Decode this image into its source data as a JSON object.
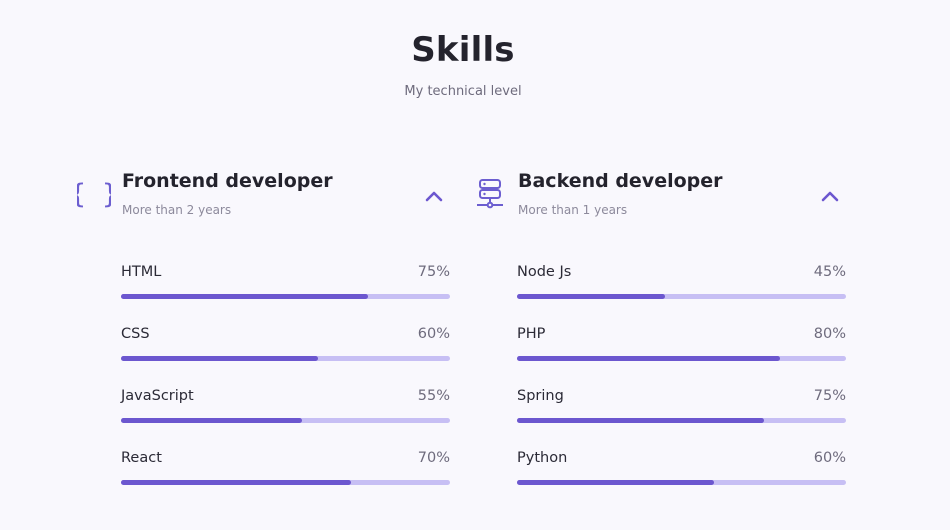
{
  "section": {
    "title": "Skills",
    "subtitle": "My technical level"
  },
  "colors": {
    "accent": "#6c57cf",
    "track": "#c7bff4",
    "background": "#f9f8fd"
  },
  "frontend": {
    "icon": "braces-icon",
    "title": "Frontend developer",
    "subtitle": "More than 2 years",
    "toggle_icon": "chevron-up-icon",
    "skills": [
      {
        "name": "HTML",
        "percent_label": "75%",
        "level": 0.75
      },
      {
        "name": "CSS",
        "percent_label": "60%",
        "level": 0.6
      },
      {
        "name": "JavaScript",
        "percent_label": "55%",
        "level": 0.55
      },
      {
        "name": "React",
        "percent_label": "70%",
        "level": 0.7
      }
    ]
  },
  "backend": {
    "icon": "server-icon",
    "title": "Backend developer",
    "subtitle": "More than 1 years",
    "toggle_icon": "chevron-up-icon",
    "skills": [
      {
        "name": "Node Js",
        "percent_label": "45%",
        "level": 0.45
      },
      {
        "name": "PHP",
        "percent_label": "80%",
        "level": 0.8
      },
      {
        "name": "Spring",
        "percent_label": "75%",
        "level": 0.75
      },
      {
        "name": "Python",
        "percent_label": "60%",
        "level": 0.6
      }
    ]
  }
}
